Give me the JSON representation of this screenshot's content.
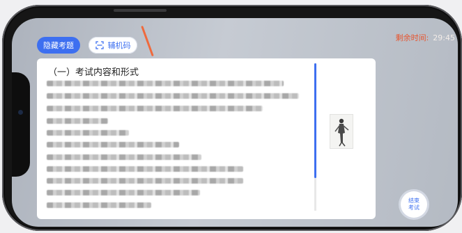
{
  "toolbar": {
    "hide_questions_label": "隐藏考题",
    "aux_code_label": "辅机码"
  },
  "timer": {
    "label": "剩余时间:",
    "value": "29:45"
  },
  "question": {
    "section_title": "（一）考试内容和形式"
  },
  "end_button": {
    "line1": "结束",
    "line2": "考试"
  },
  "colors": {
    "accent": "#3d6ff0",
    "timer_label": "#e8552f"
  },
  "icons": {
    "aux_code": "scan-icon",
    "thumbnail": "figure-image"
  }
}
